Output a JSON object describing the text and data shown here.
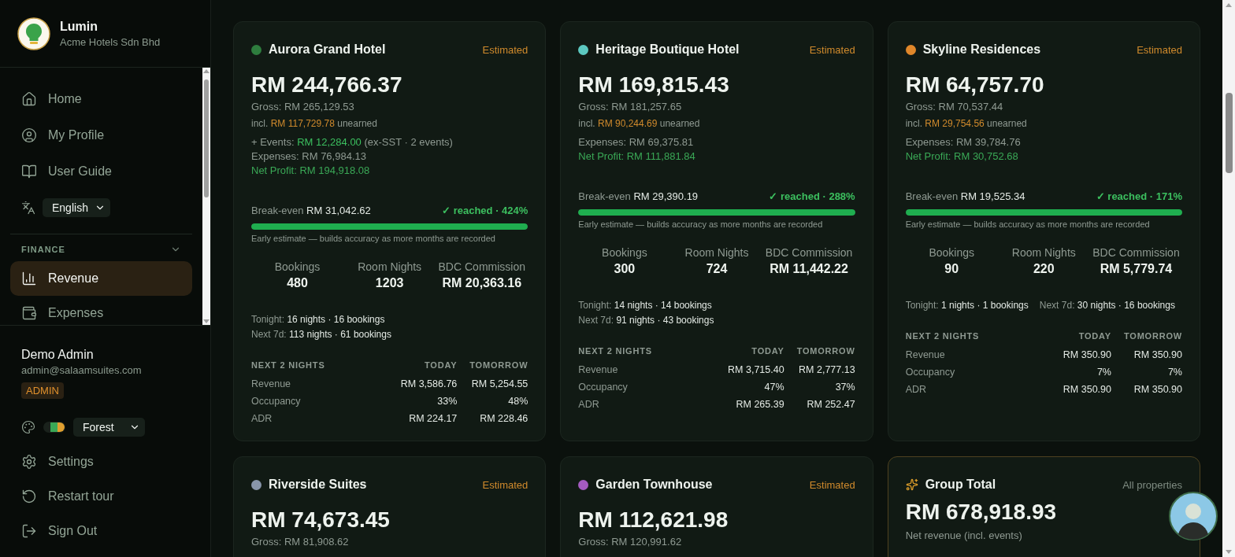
{
  "sidebar": {
    "brand": {
      "name": "Lumin",
      "org": "Acme Hotels Sdn Bhd"
    },
    "nav": [
      {
        "label": "Home",
        "selected": false
      },
      {
        "label": "My Profile",
        "selected": false
      },
      {
        "label": "User Guide",
        "selected": false
      }
    ],
    "language": {
      "value": "English"
    },
    "section": {
      "title": "FINANCE",
      "expanded": true,
      "items": [
        {
          "label": "Revenue",
          "selected": true
        },
        {
          "label": "Expenses",
          "selected": false
        }
      ]
    },
    "user": {
      "name": "Demo Admin",
      "email": "admin@salaamsuites.com",
      "role": "ADMIN"
    },
    "theme": {
      "value": "Forest"
    },
    "actions": [
      {
        "label": "Settings"
      },
      {
        "label": "Restart tour"
      },
      {
        "label": "Sign Out"
      }
    ]
  },
  "properties": [
    {
      "name": "Aurora Grand Hotel",
      "color": "#2e7d3e",
      "status": "Estimated",
      "net": "RM 244,766.37",
      "gross": "Gross: RM 265,129.53",
      "unearned": {
        "prefix": "incl.",
        "amount": "RM 117,729.78",
        "suffix": "unearned"
      },
      "events": {
        "prefix": "+ Events:",
        "amount": "RM 12,284.00",
        "suffix": "(ex-SST · 2 events)"
      },
      "expenses": "Expenses: RM 76,984.13",
      "net_profit": "Net Profit: RM 194,918.08",
      "breakeven": {
        "label": "Break-even",
        "amount": "RM 31,042.62",
        "status": "✓ reached · 424%",
        "reached": true,
        "level": 1
      },
      "note": "Early estimate — builds accuracy as more months are recorded",
      "stats": [
        {
          "label": "Bookings",
          "value": "480"
        },
        {
          "label": "Room Nights",
          "value": "1203"
        },
        {
          "label": "BDC Commission",
          "value": "RM 20,363.16"
        }
      ],
      "schedule": [
        [
          {
            "label": "Tonight:",
            "value": "16 nights · 16 bookings"
          }
        ],
        [
          {
            "label": "Next 7d:",
            "value": "113 nights · 61 bookings"
          }
        ]
      ],
      "next_nights": {
        "columns": [
          "NEXT 2 NIGHTS",
          "TODAY",
          "TOMORROW"
        ],
        "rows": [
          {
            "label": "Revenue",
            "values": [
              "RM 3,586.76",
              "RM 5,254.55"
            ]
          },
          {
            "label": "Occupancy",
            "values": [
              "33%",
              "48%"
            ]
          },
          {
            "label": "ADR",
            "values": [
              "RM 224.17",
              "RM 228.46"
            ]
          }
        ]
      }
    },
    {
      "name": "Heritage Boutique Hotel",
      "color": "#5cc8c0",
      "status": "Estimated",
      "net": "RM 169,815.43",
      "gross": "Gross: RM 181,257.65",
      "unearned": {
        "prefix": "incl.",
        "amount": "RM 90,244.69",
        "suffix": "unearned"
      },
      "expenses": "Expenses: RM 69,375.81",
      "net_profit": "Net Profit: RM 111,881.84",
      "breakeven": {
        "label": "Break-even",
        "amount": "RM 29,390.19",
        "status": "✓ reached · 288%",
        "reached": true,
        "level": 1
      },
      "note": "Early estimate — builds accuracy as more months are recorded",
      "stats": [
        {
          "label": "Bookings",
          "value": "300"
        },
        {
          "label": "Room Nights",
          "value": "724"
        },
        {
          "label": "BDC Commission",
          "value": "RM 11,442.22"
        }
      ],
      "schedule": [
        [
          {
            "label": "Tonight:",
            "value": "14 nights · 14 bookings"
          }
        ],
        [
          {
            "label": "Next 7d:",
            "value": "91 nights · 43 bookings"
          }
        ]
      ],
      "next_nights": {
        "columns": [
          "NEXT 2 NIGHTS",
          "TODAY",
          "TOMORROW"
        ],
        "rows": [
          {
            "label": "Revenue",
            "values": [
              "RM 3,715.40",
              "RM 2,777.13"
            ]
          },
          {
            "label": "Occupancy",
            "values": [
              "47%",
              "37%"
            ]
          },
          {
            "label": "ADR",
            "values": [
              "RM 265.39",
              "RM 252.47"
            ]
          }
        ]
      }
    },
    {
      "name": "Skyline Residences",
      "color": "#e0872a",
      "status": "Estimated",
      "net": "RM 64,757.70",
      "gross": "Gross: RM 70,537.44",
      "unearned": {
        "prefix": "incl.",
        "amount": "RM 29,754.56",
        "suffix": "unearned"
      },
      "expenses": "Expenses: RM 39,784.76",
      "net_profit": "Net Profit: RM 30,752.68",
      "breakeven": {
        "label": "Break-even",
        "amount": "RM 19,525.34",
        "status": "✓ reached · 171%",
        "reached": true,
        "level": 1
      },
      "note": "Early estimate — builds accuracy as more months are recorded",
      "stats": [
        {
          "label": "Bookings",
          "value": "90"
        },
        {
          "label": "Room Nights",
          "value": "220"
        },
        {
          "label": "BDC Commission",
          "value": "RM 5,779.74"
        }
      ],
      "schedule": [
        [
          {
            "label": "Tonight:",
            "value": "1 nights · 1 bookings"
          },
          {
            "label": "Next 7d:",
            "value": "30 nights · 16 bookings"
          }
        ]
      ],
      "next_nights": {
        "columns": [
          "NEXT 2 NIGHTS",
          "TODAY",
          "TOMORROW"
        ],
        "rows": [
          {
            "label": "Revenue",
            "values": [
              "RM 350.90",
              "RM 350.90"
            ]
          },
          {
            "label": "Occupancy",
            "values": [
              "7%",
              "7%"
            ]
          },
          {
            "label": "ADR",
            "values": [
              "RM 350.90",
              "RM 350.90"
            ]
          }
        ]
      }
    },
    {
      "name": "Riverside Suites",
      "color": "#8895aa",
      "status": "Estimated",
      "net": "RM 74,673.45",
      "gross": "Gross: RM 81,908.62"
    },
    {
      "name": "Garden Townhouse",
      "color": "#a45bc0",
      "status": "Estimated",
      "net": "RM 112,621.98",
      "gross": "Gross: RM 120,991.62"
    }
  ],
  "group_total": {
    "title": "Group Total",
    "scope": "All properties",
    "net": "RM 678,918.93",
    "caption": "Net revenue (incl. events)"
  }
}
